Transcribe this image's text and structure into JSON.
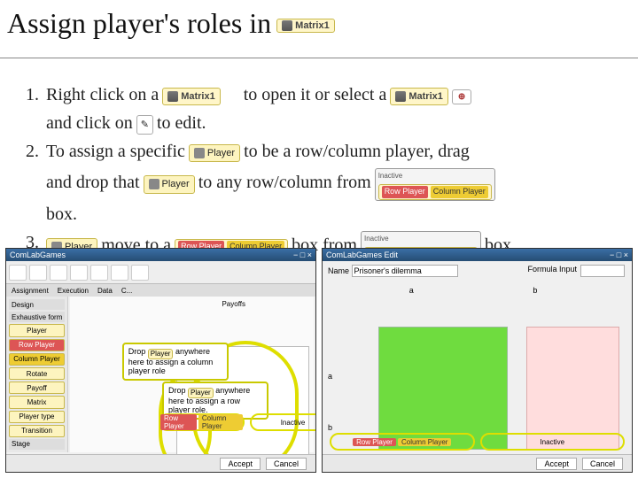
{
  "title_prefix": "Assign player's roles in",
  "matrix_label": "Matrix1",
  "player_label": "Player",
  "row_player_label": "Row Player",
  "column_player_label": "Column Player",
  "inactive_label": "Inactive",
  "steps": {
    "s1": {
      "num": "1.",
      "a": "Right click on a",
      "b": "to open it or select a",
      "c": "and click on",
      "d": "to edit."
    },
    "s2": {
      "num": "2.",
      "a": "To assign a specific",
      "b": "to be a row/column player, drag",
      "c": "and drop that",
      "d": "to any row/column from",
      "e": "box."
    },
    "s3": {
      "num": "3.",
      "a": "move to a",
      "b": "box from",
      "c": "box."
    }
  },
  "callouts": {
    "col": "Drop          anywhere here to assign a column player role",
    "row": "Drop          anywhere here to assign a row player role."
  },
  "win1": {
    "title": "ComLabGames",
    "tabs": [
      "Assignment",
      "Execution",
      "Data",
      "C..."
    ],
    "side_top": [
      "Design",
      "Exhaustive form"
    ],
    "side_buttons": [
      "Player",
      "Rotate",
      "Payoff",
      "Matrix",
      "Player type",
      "Transition"
    ],
    "payoffs_label": "Payoffs"
  },
  "win2": {
    "title": "ComLabGames Edit",
    "name_label": "Name",
    "name_value": "Prisoner's dilemma",
    "formula_label": "Formula Input",
    "cols": [
      "a",
      "b"
    ],
    "rows": [
      "a",
      "b"
    ]
  },
  "footer": {
    "accept": "Accept",
    "cancel": "Cancel"
  }
}
